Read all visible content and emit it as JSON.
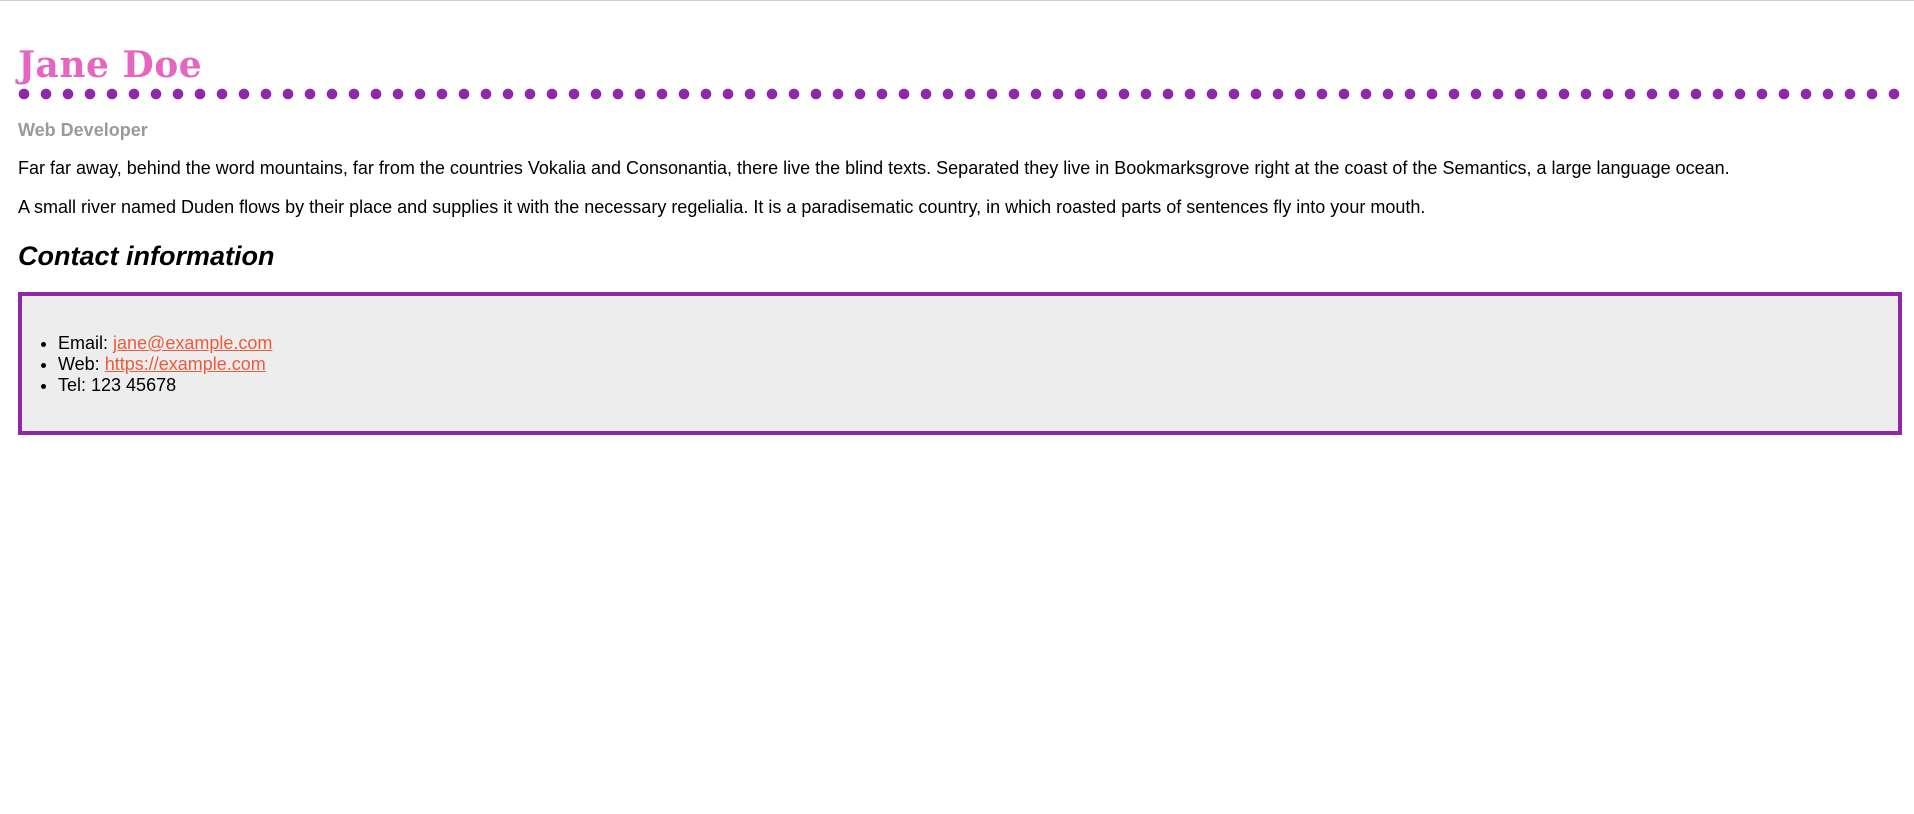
{
  "profile": {
    "name": "Jane Doe",
    "role": "Web Developer",
    "paragraphs": [
      "Far far away, behind the word mountains, far from the countries Vokalia and Consonantia, there live the blind texts. Separated they live in Bookmarksgrove right at the coast of the Semantics, a large language ocean.",
      "A small river named Duden flows by their place and supplies it with the necessary regelialia. It is a paradisematic country, in which roasted parts of sentences fly into your mouth."
    ]
  },
  "contact": {
    "title": "Contact information",
    "email_label": "Email: ",
    "email": "jane@example.com",
    "web_label": "Web: ",
    "web": "https://example.com",
    "tel_label": "Tel: ",
    "tel": "123 45678"
  },
  "colors": {
    "name": "#e466c1",
    "accent_border": "#8e27a8",
    "link": "#ee5a3c",
    "muted": "#9a9a9a",
    "contact_bg": "#ededed"
  }
}
